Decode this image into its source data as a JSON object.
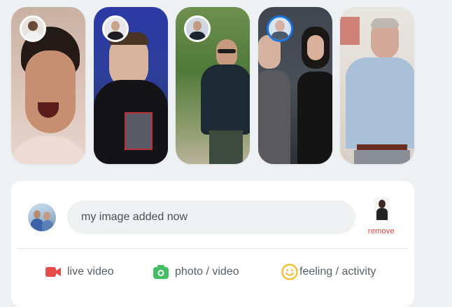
{
  "stories": [
    {
      "name": "story-1"
    },
    {
      "name": "story-2"
    },
    {
      "name": "story-3"
    },
    {
      "name": "story-4"
    },
    {
      "name": "story-5"
    }
  ],
  "composer": {
    "input_value": "my image added now",
    "remove_label": "remove",
    "actions": [
      {
        "label": "live video",
        "icon": "video-camera-icon",
        "color": "#e94b4b"
      },
      {
        "label": "photo / video",
        "icon": "camera-icon",
        "color": "#45bd62"
      },
      {
        "label": "feeling / activity",
        "icon": "smiley-icon",
        "color": "#f7b928"
      }
    ]
  },
  "colors": {
    "page_bg": "#eef1f4",
    "card_bg": "#ffffff",
    "input_bg": "#eff1f3",
    "remove": "#e0403a",
    "ring_blue": "#1b74e4"
  }
}
